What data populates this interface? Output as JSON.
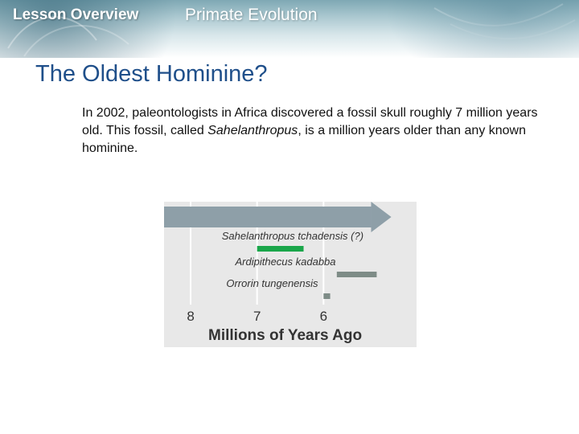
{
  "header": {
    "lesson_label": "Lesson Overview",
    "section_label": "Primate Evolution"
  },
  "slide": {
    "title": "The Oldest Hominine?",
    "body_before": "In 2002, paleontologists in Africa discovered a fossil skull roughly 7 million years old. This fossil, called ",
    "body_italic": "Sahelanthropus",
    "body_after": ", is a million years older than any known hominine."
  },
  "chart_data": {
    "type": "bar",
    "xlabel": "Millions of Years Ago",
    "x_ticks": [
      "8",
      "7",
      "6"
    ],
    "xlim": [
      8.4,
      4.6
    ],
    "series": [
      {
        "name": "Sahelanthropus tchadensis (?)",
        "start": 7.0,
        "end": 6.3,
        "color": "#1aa64a"
      },
      {
        "name": "Ardipithecus kadabba",
        "start": 5.8,
        "end": 5.2,
        "color": "#7e8c87"
      },
      {
        "name": "Orrorin tungenensis",
        "start": 6.0,
        "end": 5.9,
        "color": "#7e8c87"
      }
    ],
    "colors": {
      "arrow": "#8e9fa8",
      "grid": "#ffffff",
      "background": "#e8e8e8"
    }
  }
}
